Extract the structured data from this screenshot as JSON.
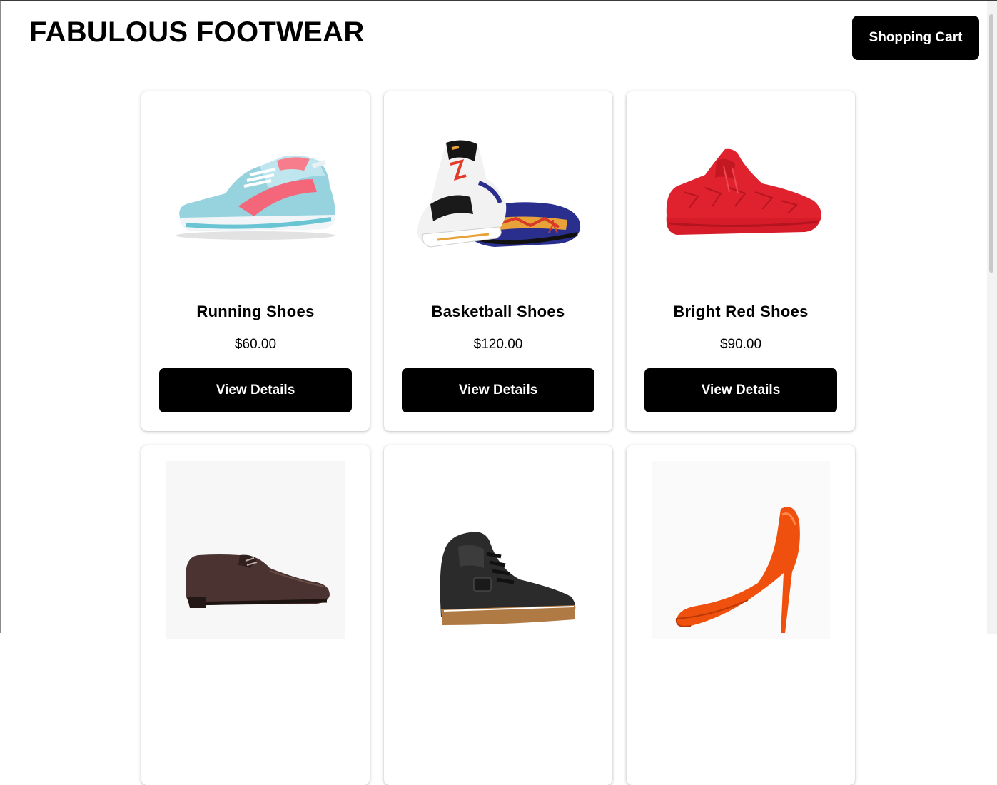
{
  "header": {
    "title": "FABULOUS FOOTWEAR",
    "cart_label": "Shopping Cart"
  },
  "products": [
    {
      "name": "Running Shoes",
      "price": "$60.00",
      "button": "View Details",
      "icon": "running-shoe-image"
    },
    {
      "name": "Basketball Shoes",
      "price": "$120.00",
      "button": "View Details",
      "icon": "basketball-shoe-image"
    },
    {
      "name": "Bright Red Shoes",
      "price": "$90.00",
      "button": "View Details",
      "icon": "red-shoe-image"
    },
    {
      "icon": "dress-shoe-image"
    },
    {
      "icon": "high-top-sneaker-image"
    },
    {
      "icon": "orange-high-heel-image"
    }
  ],
  "colors": {
    "button_bg": "#000000",
    "button_text": "#ffffff",
    "page_bg": "#ffffff"
  }
}
